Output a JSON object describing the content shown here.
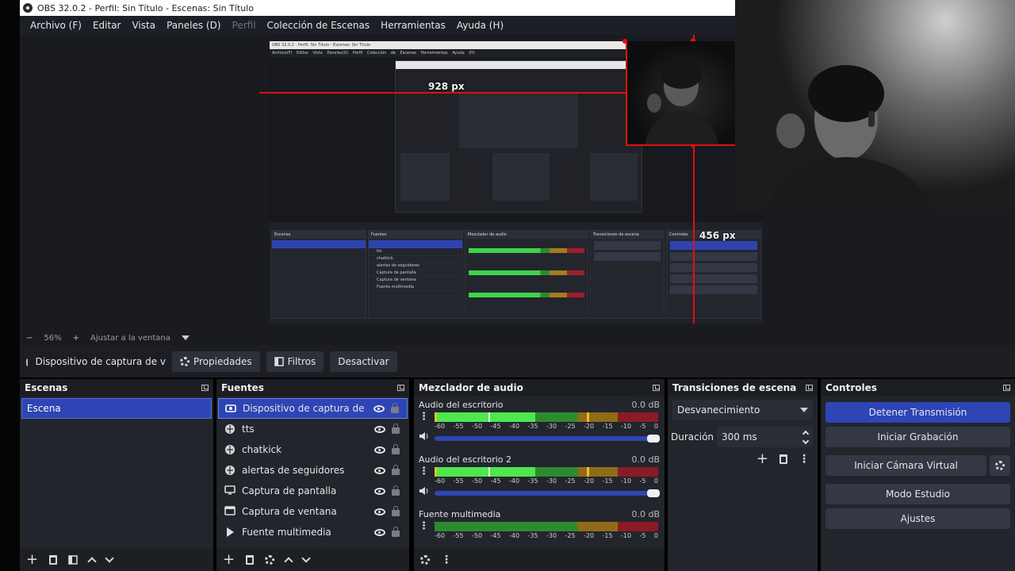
{
  "window": {
    "title": "OBS 32.0.2 - Perfil: Sin Título - Escenas: Sin Título"
  },
  "menu": [
    "Archivo (F)",
    "Editar",
    "Vista",
    "Paneles (D)",
    "Perfil",
    "Colección de Escenas",
    "Herramientas",
    "Ayuda (H)"
  ],
  "preview": {
    "width_label": "928 px",
    "height_label": "456 px",
    "nested_title": "OBS 32.0.2 - Perfil: Sin Título - Escenas: Sin Título",
    "nested_menu": "Archivo(F) Editar Vista Paneles(D) Perfil Colección de Escenas Herramientas Ayuda (H)"
  },
  "zoom": {
    "minus": "−",
    "value": "56%",
    "plus": "+",
    "fit": "Ajustar a la ventana"
  },
  "source_toolbar": {
    "source_name": "Dispositivo de captura de v",
    "properties": "Propiedades",
    "filters": "Filtros",
    "deactivate": "Desactivar"
  },
  "scenes": {
    "title": "Escenas",
    "items": [
      "Escena"
    ]
  },
  "sources": {
    "title": "Fuentes",
    "items": [
      {
        "label": "Dispositivo de captura de video",
        "icon": "camera-icon"
      },
      {
        "label": "tts",
        "icon": "globe-icon"
      },
      {
        "label": "chatkick",
        "icon": "globe-icon"
      },
      {
        "label": "alertas de seguidores",
        "icon": "globe-icon"
      },
      {
        "label": "Captura de pantalla",
        "icon": "monitor-icon"
      },
      {
        "label": "Captura de ventana",
        "icon": "window-icon"
      },
      {
        "label": "Fuente multimedia",
        "icon": "play-icon"
      }
    ]
  },
  "mixer": {
    "title": "Mezclador de audio",
    "channels": [
      {
        "name": "Audio del escritorio",
        "db": "0.0 dB"
      },
      {
        "name": "Audio del escritorio 2",
        "db": "0.0 dB"
      },
      {
        "name": "Fuente multimedia",
        "db": "0.0 dB"
      }
    ],
    "scale": [
      "-60",
      "-55",
      "-50",
      "-45",
      "-40",
      "-35",
      "-30",
      "-25",
      "-20",
      "-15",
      "-10",
      "-5",
      "0"
    ]
  },
  "transitions": {
    "title": "Transiciones de escena",
    "selected": "Desvanecimiento",
    "duration_label": "Duración",
    "duration_value": "300 ms"
  },
  "controls": {
    "title": "Controles",
    "stop_stream": "Detener Transmisión",
    "start_recording": "Iniciar Grabación",
    "start_virtual_cam": "Iniciar Cámara Virtual",
    "studio_mode": "Modo Estudio",
    "settings": "Ajustes"
  },
  "colors": {
    "accent": "#2d45b5",
    "guide_red": "#e01010",
    "dock_bg": "#23252c"
  }
}
